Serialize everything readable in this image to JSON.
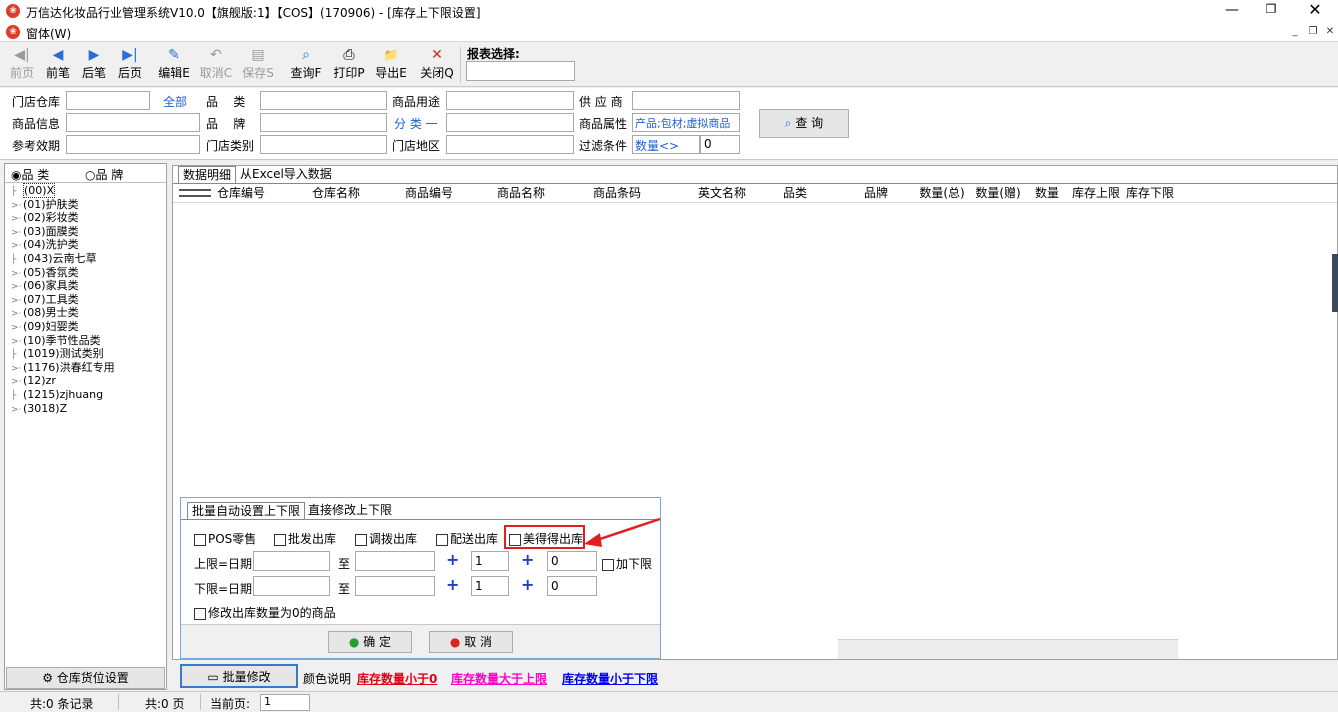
{
  "window": {
    "title": "万信达化妆品行业管理系统V10.0【旗舰版:1】【COS】(170906) - [库存上下限设置]",
    "menu": "窗体(W)"
  },
  "toolbar": {
    "buttons": [
      {
        "label": "前页",
        "icon": "first-page-icon",
        "glyph": "◀|",
        "enabled": false
      },
      {
        "label": "前笔",
        "icon": "previous-icon",
        "glyph": "◀",
        "enabled": true
      },
      {
        "label": "后笔",
        "icon": "next-icon",
        "glyph": "▶",
        "enabled": true
      },
      {
        "label": "后页",
        "icon": "last-page-icon",
        "glyph": "▶|",
        "enabled": true
      },
      {
        "label": "编辑E",
        "icon": "edit-icon",
        "glyph": "✎",
        "enabled": true
      },
      {
        "label": "取消C",
        "icon": "undo-icon",
        "glyph": "↶",
        "enabled": false
      },
      {
        "label": "保存S",
        "icon": "save-icon",
        "glyph": "▤",
        "enabled": false
      },
      {
        "label": "查询F",
        "icon": "search-icon",
        "glyph": "⌕",
        "enabled": true
      },
      {
        "label": "打印P",
        "icon": "print-icon",
        "glyph": "⎙",
        "enabled": true
      },
      {
        "label": "导出E",
        "icon": "export-icon",
        "glyph": "📁",
        "enabled": true
      },
      {
        "label": "关闭Q",
        "icon": "close-icon",
        "glyph": "✕",
        "enabled": true
      }
    ],
    "report_select_label": "报表选择:",
    "report_select_value": ""
  },
  "filter": {
    "row1": {
      "store_warehouse": "门店仓库",
      "all_link": "全部",
      "category": "品    类",
      "usage": "商品用途",
      "supplier": "供 应 商"
    },
    "row2": {
      "product_info": "商品信息",
      "brand": "品    牌",
      "class_link": "分 类 一",
      "attribute": "商品属性",
      "attribute_value": "产品;包材;虚拟商品"
    },
    "row3": {
      "ref_period": "参考效期",
      "store_type": "门店类别",
      "store_region": "门店地区",
      "filter_cond": "过滤条件",
      "qty_link": "数量<>",
      "qty_value": "0"
    },
    "query_button": "查 询"
  },
  "left_panel": {
    "radio_category": "品 类",
    "radio_brand": "品 牌",
    "tree": [
      {
        "label": "(00)X",
        "expandable": false,
        "selected": true
      },
      {
        "label": "(01)护肤类",
        "expandable": true
      },
      {
        "label": "(02)彩妆类",
        "expandable": true
      },
      {
        "label": "(03)面膜类",
        "expandable": true
      },
      {
        "label": "(04)洗护类",
        "expandable": true
      },
      {
        "label": "(043)云南七草",
        "expandable": false
      },
      {
        "label": "(05)香氛类",
        "expandable": true
      },
      {
        "label": "(06)家具类",
        "expandable": true
      },
      {
        "label": "(07)工具类",
        "expandable": true
      },
      {
        "label": "(08)男士类",
        "expandable": true
      },
      {
        "label": "(09)妇婴类",
        "expandable": true
      },
      {
        "label": "(10)季节性品类",
        "expandable": true
      },
      {
        "label": "(1019)测试类别",
        "expandable": false
      },
      {
        "label": "(1176)洪春红专用",
        "expandable": true
      },
      {
        "label": "(12)zr",
        "expandable": true
      },
      {
        "label": "(1215)zjhuang",
        "expandable": false
      },
      {
        "label": "(3018)Z",
        "expandable": true
      }
    ],
    "warehouse_button": "仓库货位设置"
  },
  "grid": {
    "tabs": [
      "数据明细",
      "从Excel导入数据"
    ],
    "columns": [
      "仓库编号",
      "仓库名称",
      "商品编号",
      "商品名称",
      "商品条码",
      "英文名称",
      "品类",
      "品牌",
      "数量(总)",
      "数量(赠)",
      "数量",
      "库存上限",
      "库存下限"
    ]
  },
  "dialog": {
    "tabs": [
      "批量自动设置上下限",
      "直接修改上下限"
    ],
    "checkboxes": [
      "POS零售",
      "批发出库",
      "调拨出库",
      "配送出库",
      "美得得出库"
    ],
    "upper_label": "上限=日期",
    "lower_label": "下限=日期",
    "to_label": "至",
    "upper_mult": "1",
    "upper_add": "0",
    "lower_mult": "1",
    "lower_add": "0",
    "add_lower_label": "加下限",
    "zero_qty_label": "修改出库数量为0的商品",
    "ok_button": "确  定",
    "cancel_button": "取  消",
    "highlight_color": "#e02020"
  },
  "bottom": {
    "batch_button": "批量修改",
    "color_legend_label": "颜色说明",
    "legend": [
      {
        "text": "库存数量小于0",
        "color": "#e0001b"
      },
      {
        "text": "库存数量大于上限",
        "color": "#ff00c8"
      },
      {
        "text": "库存数量小于下限",
        "color": "#0000ee"
      }
    ]
  },
  "status": {
    "records": "共:0 条记录",
    "pages": "共:0 页",
    "current_page_label": "当前页:",
    "current_page": "1"
  }
}
